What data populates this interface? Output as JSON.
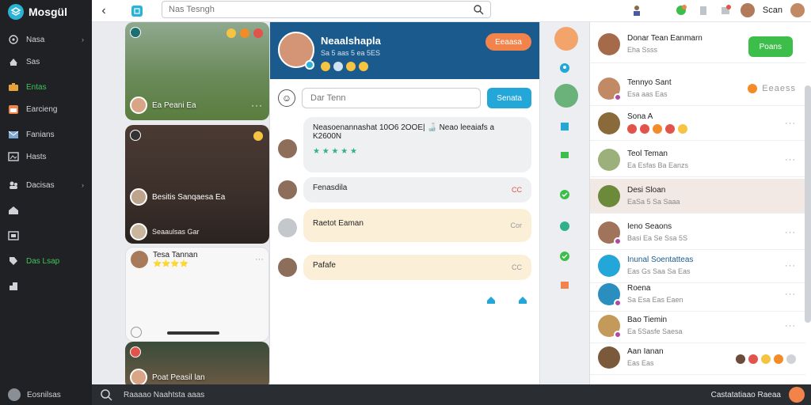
{
  "brand": {
    "name": "Mosgül"
  },
  "sidebar": {
    "items": [
      {
        "label": "Nasa",
        "icon": "home-icon",
        "chev": "›"
      },
      {
        "label": "Sas",
        "icon": "explore-icon",
        "chev": ""
      },
      {
        "label": "Entas",
        "icon": "briefcase-icon",
        "chev": ""
      },
      {
        "label": "Earcieng",
        "icon": "calendar-icon",
        "chev": ""
      },
      {
        "label": "Fanians",
        "icon": "mail-icon",
        "chev": ""
      },
      {
        "label": "Hasts",
        "icon": "image-icon",
        "chev": ""
      },
      {
        "label": "Dacisas",
        "icon": "group-icon",
        "chev": "›"
      },
      {
        "label": "",
        "icon": "house-icon",
        "chev": ""
      },
      {
        "label": "",
        "icon": "photo-icon",
        "chev": ""
      },
      {
        "label": "Das Lsap",
        "icon": "tag-icon",
        "chev": ""
      },
      {
        "label": "",
        "icon": "puzzle-icon",
        "chev": ""
      }
    ],
    "footer_label": "Eosnilsas"
  },
  "topbar": {
    "search_placeholder": "Nas Tesngh",
    "user_name": "Scan"
  },
  "feed": {
    "card1": {
      "name": "Ea Peani Ea"
    },
    "card2": {
      "caption": "Besitis Sanqaesa Ea",
      "caption2": "Seaaulsas Gar"
    },
    "card3": {
      "name": "Tesa Tannan",
      "meta": "⭐⭐⭐⭐"
    },
    "card4": {
      "name": "Poat Peasil lan"
    }
  },
  "chat": {
    "name": "Neaalshapla",
    "meta": "Sa 5 aas 5 ea 5ES",
    "follow_label": "Eeaasa",
    "compose_placeholder": "Dar Tenn",
    "send_label": "Senata",
    "messages": [
      {
        "text": "Neasoenannashat 10O6 2OOE| 🍶  Neao leeaiafs a K2600N",
        "stars": "★ ★ ★ ★ ★"
      },
      {
        "text": "Fenasdila",
        "tail": "CC"
      },
      {
        "text": "Raetot Eaman",
        "tail": "Cor"
      },
      {
        "text": "Pafafe",
        "tail": "CC"
      }
    ]
  },
  "contacts": {
    "add_label": "Poans",
    "rows": [
      {
        "name": "Donar Tean Eanmarn",
        "meta": "Eha Ssss"
      },
      {
        "name": "Tennyo Sant",
        "meta": "Esa aas Eas"
      },
      {
        "name": "Sona A",
        "meta": ""
      },
      {
        "name": "Teol Teman",
        "meta": "Ea Esfas Ba Eanzs"
      },
      {
        "name": "Desi Sloan",
        "meta": "EaSa 5 Sa Saaa"
      },
      {
        "name": "Ieno Seaons",
        "meta": "Basi Ea Se Ssa 5S"
      },
      {
        "name": "Inunal Soentatteas",
        "meta": "Eas Gs Saa Sa Eas"
      },
      {
        "name": "Roena",
        "meta": "Sa Esa Eas Eaen"
      },
      {
        "name": "Bao Tiemin",
        "meta": "Ea 5Sasfe Saesa"
      },
      {
        "name": "Aan Ianan",
        "meta": "Eas Eas"
      }
    ]
  },
  "bottombar": {
    "left_text": "Raaaao Naahtsta aaas",
    "right_text": "Castatatiaao Raeaa"
  },
  "colors": {
    "accent": "#2ab3d6",
    "chat_header": "#1b5a8c",
    "follow": "#f2844b",
    "add_friend": "#3dbe4a"
  }
}
